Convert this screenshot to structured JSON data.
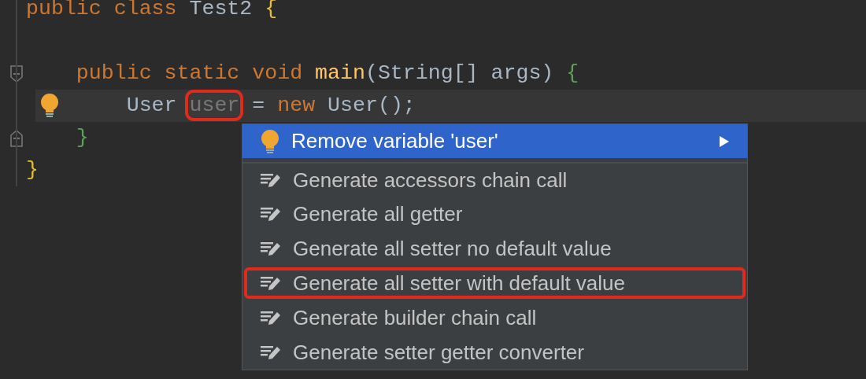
{
  "code_lines": [
    {
      "tokens": [
        {
          "text": "public class ",
          "kind": "keyword"
        },
        {
          "text": "Test2 ",
          "kind": "plain"
        },
        {
          "text": "{",
          "kind": "brace_outer"
        }
      ]
    },
    {
      "blank_line_before": true,
      "fold_start": true,
      "current": false,
      "tokens": [
        {
          "text": "    public static void ",
          "kind": "keyword"
        },
        {
          "text": "main",
          "kind": "method"
        },
        {
          "text": "(String[] args) ",
          "kind": "plain"
        },
        {
          "text": "{",
          "kind": "brace_inner"
        }
      ]
    },
    {
      "bulb": true,
      "current": true,
      "tokens": [
        {
          "text": "        User ",
          "kind": "plain"
        },
        {
          "text": "user",
          "kind": "unused",
          "highlighted": true
        },
        {
          "text": " = ",
          "kind": "plain"
        },
        {
          "text": "new ",
          "kind": "keyword"
        },
        {
          "text": "User();",
          "kind": "plain"
        }
      ]
    },
    {
      "fold_end": true,
      "current": false,
      "tokens": [
        {
          "text": "    }",
          "kind": "brace_inner"
        }
      ]
    },
    {
      "tokens": [
        {
          "text": "}",
          "kind": "brace_outer"
        }
      ]
    }
  ],
  "menu": {
    "items": [
      {
        "label": "Remove variable 'user'",
        "kind": "intention",
        "selected": true,
        "has_submenu": true,
        "highlighted": false
      },
      {
        "label": "Generate accessors chain call",
        "kind": "generate",
        "selected": false,
        "has_submenu": false,
        "highlighted": false
      },
      {
        "label": "Generate all getter",
        "kind": "generate",
        "selected": false,
        "has_submenu": false,
        "highlighted": false
      },
      {
        "label": "Generate all setter no default value",
        "kind": "generate",
        "selected": false,
        "has_submenu": false,
        "highlighted": false
      },
      {
        "label": "Generate all setter with default value",
        "kind": "generate",
        "selected": false,
        "has_submenu": false,
        "highlighted": true
      },
      {
        "label": "Generate builder chain call",
        "kind": "generate",
        "selected": false,
        "has_submenu": false,
        "highlighted": false
      },
      {
        "label": "Generate setter getter converter",
        "kind": "generate",
        "selected": false,
        "has_submenu": false,
        "highlighted": false
      }
    ]
  }
}
